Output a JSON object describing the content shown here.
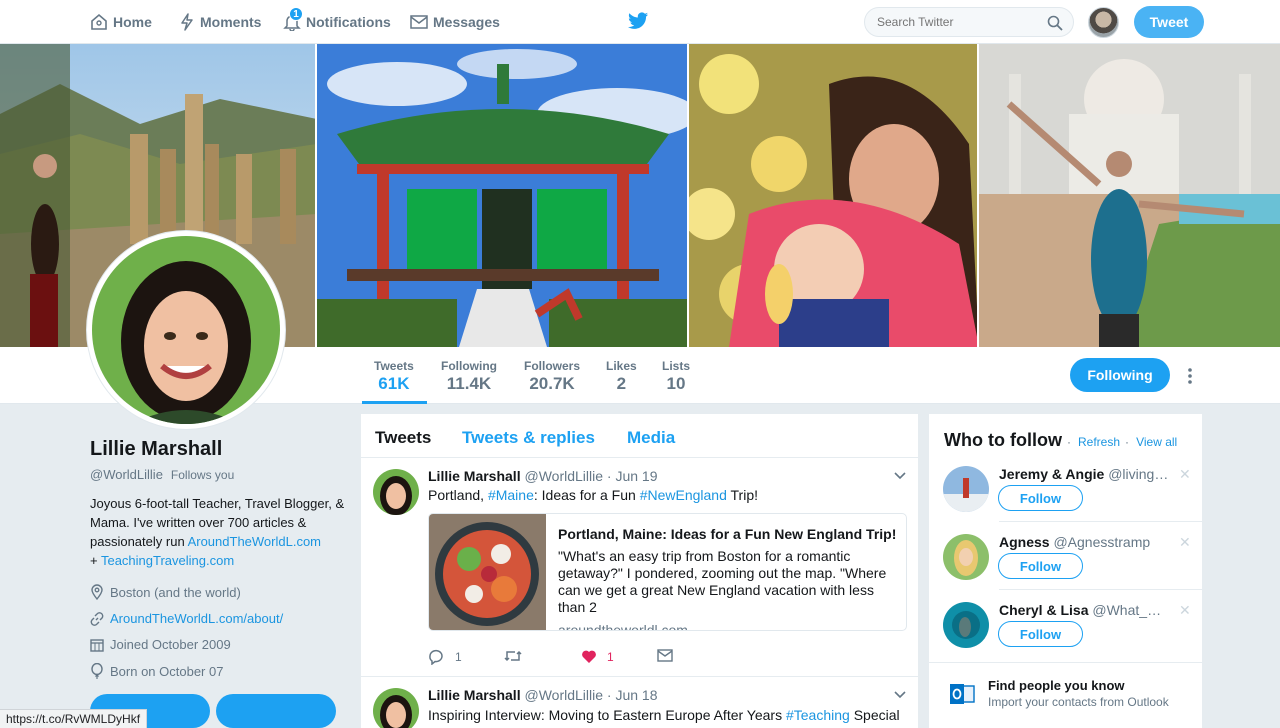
{
  "nav": {
    "home": "Home",
    "moments": "Moments",
    "notifications": "Notifications",
    "notifications_count": "1",
    "messages": "Messages",
    "search_placeholder": "Search Twitter",
    "tweet_button": "Tweet"
  },
  "profile": {
    "name": "Lillie Marshall",
    "handle": "@WorldLillie",
    "follows_you": "Follows you",
    "bio_text": "Joyous 6-foot-tall Teacher, Travel Blogger, & Mama. I've written over 700 articles & passionately run ",
    "bio_link1": "AroundTheWorldL.com",
    "bio_plus": "+ ",
    "bio_link2": "TeachingTraveling.com",
    "location": "Boston (and the world)",
    "website": "AroundTheWorldL.com/about/",
    "joined": "Joined October 2009",
    "born": "Born on October 07"
  },
  "stats": [
    {
      "label": "Tweets",
      "value": "61K"
    },
    {
      "label": "Following",
      "value": "11.4K"
    },
    {
      "label": "Followers",
      "value": "20.7K"
    },
    {
      "label": "Likes",
      "value": "2"
    },
    {
      "label": "Lists",
      "value": "10"
    }
  ],
  "following_button": "Following",
  "tabs": [
    "Tweets",
    "Tweets & replies",
    "Media"
  ],
  "tweets": [
    {
      "name": "Lillie Marshall",
      "handle": "@WorldLillie",
      "date": "· Jun 19",
      "text_a": "Portland, ",
      "tag1": "#Maine",
      "text_b": ": Ideas for a Fun ",
      "tag2": "#NewEngland",
      "text_c": " Trip!",
      "card_title": "Portland, Maine: Ideas for a Fun New England Trip!",
      "card_desc": "\"What's an easy trip from Boston for a romantic getaway?\" I pondered, zooming out the map. \"Where can we get a great New England vacation with less than 2",
      "card_url": "aroundtheworldl.com",
      "replies": "1",
      "likes": "1"
    },
    {
      "name": "Lillie Marshall",
      "handle": "@WorldLillie",
      "date": "· Jun 18",
      "text_a": "Inspiring Interview: Moving to Eastern Europe After Years ",
      "tag1": "#Teaching",
      "text_b": " Special"
    }
  ],
  "who_to_follow": {
    "title": "Who to follow",
    "refresh": "Refresh",
    "view_all": "View all",
    "follow_label": "Follow",
    "people": [
      {
        "name": "Jeremy & Angie",
        "handle": "@livingdr…"
      },
      {
        "name": "Agness",
        "handle": "@Agnesstramp"
      },
      {
        "name": "Cheryl & Lisa",
        "handle": "@What_Bou…"
      }
    ],
    "find_title": "Find people you know",
    "find_sub": "Import your contacts from Outlook"
  },
  "status_url": "https://t.co/RvWMLDyHkf",
  "colors": {
    "accent": "#1da1f2",
    "like": "#e0245e"
  }
}
